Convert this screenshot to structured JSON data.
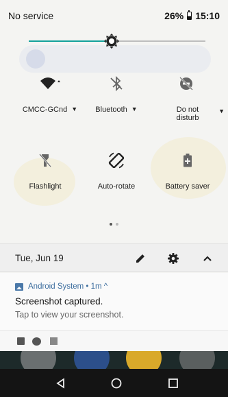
{
  "status_bar": {
    "carrier": "No service",
    "battery": "26%",
    "time": "15:10"
  },
  "brightness": {
    "level": 0.47
  },
  "quick_tiles": [
    {
      "icon": "wifi-icon",
      "label": "CMCC-GCnd",
      "has_caret": true
    },
    {
      "icon": "bluetooth-off-icon",
      "label": "Bluetooth",
      "has_caret": true
    },
    {
      "icon": "do-not-disturb-icon",
      "label": "Do not disturb",
      "has_caret": true
    },
    {
      "icon": "flashlight-icon",
      "label": "Flashlight"
    },
    {
      "icon": "auto-rotate-icon",
      "label": "Auto-rotate"
    },
    {
      "icon": "battery-saver-icon",
      "label": "Battery saver"
    }
  ],
  "page_indicator": {
    "current": 1,
    "total": 2
  },
  "date_bar": {
    "date": "Tue, Jun 19"
  },
  "notification": {
    "app": "Android System • 1m ^",
    "title": "Screenshot captured.",
    "text": "Tap to view your screenshot."
  },
  "colors": {
    "accent": "#12a19a",
    "notification_app": "#3c6d9e",
    "navbar": "#141414"
  }
}
